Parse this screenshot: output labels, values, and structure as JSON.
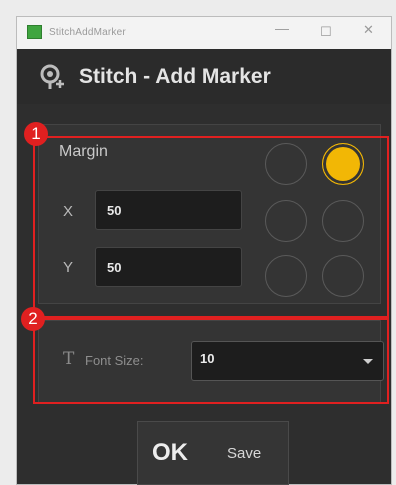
{
  "window": {
    "title": "StitchAddMarker",
    "minimize_glyph": "—",
    "maximize_glyph": "☐",
    "close_glyph": "✕"
  },
  "header": {
    "title": "Stitch - Add Marker",
    "icon": "stitch-marker-icon"
  },
  "margin": {
    "title": "Margin",
    "x_label": "X",
    "x_value": "50",
    "y_label": "Y",
    "y_value": "50",
    "anchor_positions": [
      "top-left",
      "top-right",
      "middle-left",
      "middle-right",
      "bottom-left",
      "bottom-right"
    ],
    "selected_anchor": "top-right"
  },
  "font": {
    "icon": "font-size-icon",
    "label": "Font Size:",
    "value": "10"
  },
  "actions": {
    "ok_label": "OK",
    "save_label": "Save"
  },
  "annotations": {
    "badge_1": "1",
    "badge_2": "2",
    "color": "#e02020"
  },
  "colors": {
    "accent": "#f2b705",
    "background": "#2e2e2e"
  }
}
